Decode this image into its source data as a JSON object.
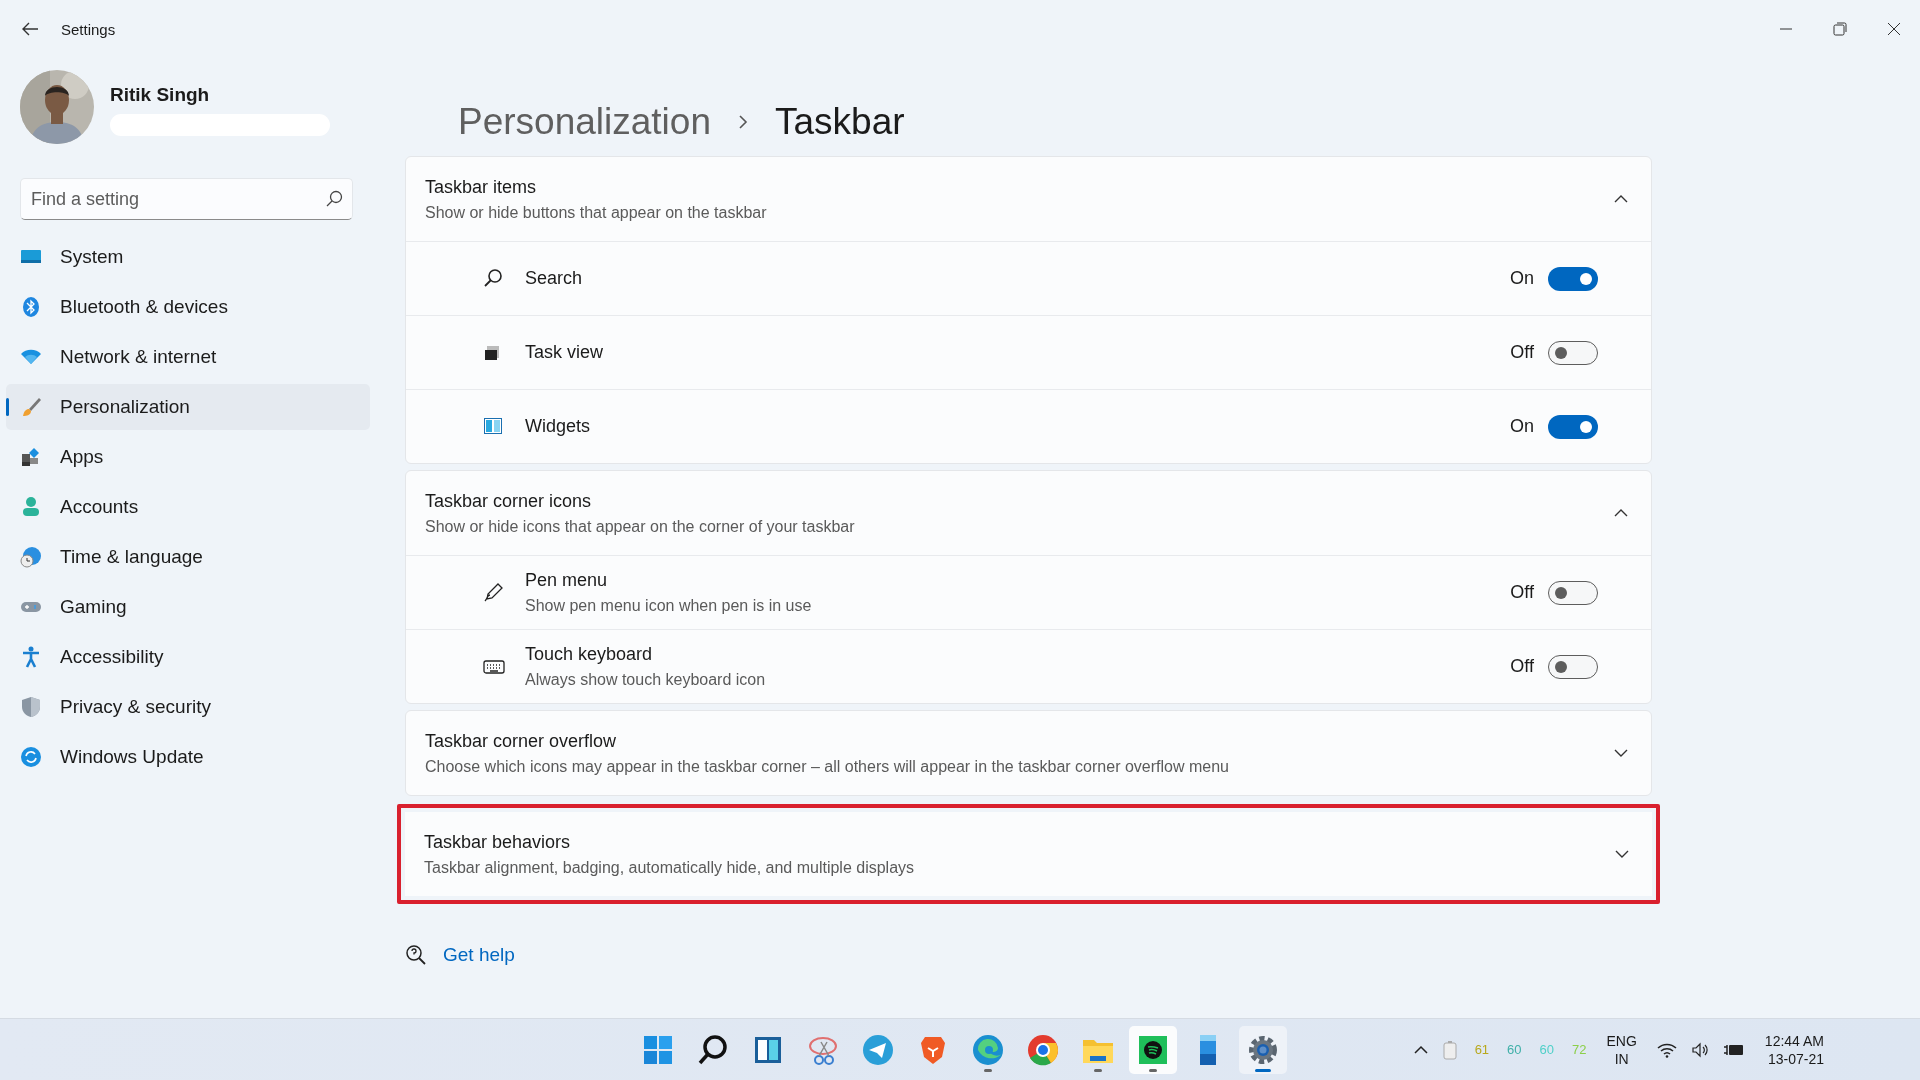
{
  "window": {
    "title": "Settings"
  },
  "profile": {
    "name": "Ritik Singh"
  },
  "search": {
    "placeholder": "Find a setting"
  },
  "sidebar": {
    "items": [
      {
        "label": "System",
        "selected": false
      },
      {
        "label": "Bluetooth & devices",
        "selected": false
      },
      {
        "label": "Network & internet",
        "selected": false
      },
      {
        "label": "Personalization",
        "selected": true
      },
      {
        "label": "Apps",
        "selected": false
      },
      {
        "label": "Accounts",
        "selected": false
      },
      {
        "label": "Time & language",
        "selected": false
      },
      {
        "label": "Gaming",
        "selected": false
      },
      {
        "label": "Accessibility",
        "selected": false
      },
      {
        "label": "Privacy & security",
        "selected": false
      },
      {
        "label": "Windows Update",
        "selected": false
      }
    ]
  },
  "breadcrumb": [
    {
      "label": "Personalization",
      "current": false
    },
    {
      "label": "Taskbar",
      "current": true
    }
  ],
  "sections": [
    {
      "title": "Taskbar items",
      "description": "Show or hide buttons that appear on the taskbar",
      "expanded": true,
      "highlighted": false,
      "items": [
        {
          "label": "Search",
          "state_label": "On",
          "on": true
        },
        {
          "label": "Task view",
          "state_label": "Off",
          "on": false
        },
        {
          "label": "Widgets",
          "state_label": "On",
          "on": true
        }
      ]
    },
    {
      "title": "Taskbar corner icons",
      "description": "Show or hide icons that appear on the corner of your taskbar",
      "expanded": true,
      "highlighted": false,
      "items": [
        {
          "label": "Pen menu",
          "description": "Show pen menu icon when pen is in use",
          "state_label": "Off",
          "on": false
        },
        {
          "label": "Touch keyboard",
          "description": "Always show touch keyboard icon",
          "state_label": "Off",
          "on": false
        }
      ]
    },
    {
      "title": "Taskbar corner overflow",
      "description": "Choose which icons may appear in the taskbar corner – all others will appear in the taskbar corner overflow menu",
      "expanded": false,
      "highlighted": false
    },
    {
      "title": "Taskbar behaviors",
      "description": "Taskbar alignment, badging, automatically hide, and multiple displays",
      "expanded": false,
      "highlighted": true
    }
  ],
  "help_link": "Get help",
  "taskbar": {
    "apps": [
      {
        "running": false,
        "selected": false,
        "hovered": false
      },
      {
        "running": false,
        "selected": false,
        "hovered": false
      },
      {
        "running": false,
        "selected": false,
        "hovered": false
      },
      {
        "running": false,
        "selected": false,
        "hovered": false
      },
      {
        "running": false,
        "selected": false,
        "hovered": false
      },
      {
        "running": false,
        "selected": false,
        "hovered": false
      },
      {
        "running": true,
        "selected": false,
        "hovered": false
      },
      {
        "running": false,
        "selected": false,
        "hovered": false
      },
      {
        "running": true,
        "selected": false,
        "hovered": false
      },
      {
        "running": true,
        "selected": false,
        "hovered": true
      },
      {
        "running": false,
        "selected": false,
        "hovered": false
      },
      {
        "running": true,
        "selected": true,
        "hovered": false
      }
    ],
    "tray": {
      "readings": [
        {
          "text": "61",
          "color": "#b8a81c"
        },
        {
          "text": "60",
          "color": "#3fb0a8"
        },
        {
          "text": "60",
          "color": "#4fd0c8"
        },
        {
          "text": "72",
          "color": "#8ccf4a"
        }
      ],
      "language": [
        "ENG",
        "IN"
      ],
      "time": "12:44 AM",
      "date": "13-07-21"
    }
  }
}
